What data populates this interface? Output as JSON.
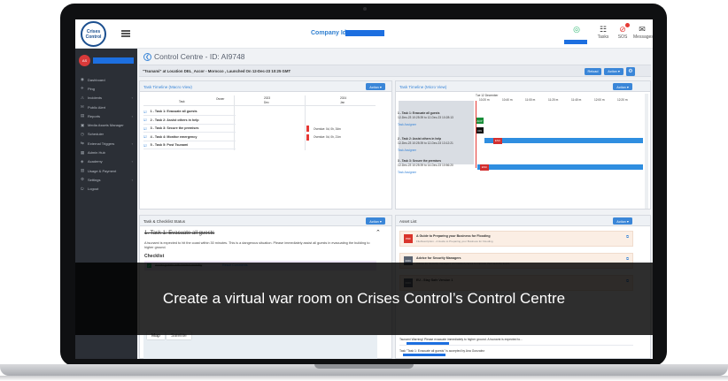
{
  "header": {
    "logo_text": "Crises Control",
    "company_label": "Company Id:",
    "tasks_label": "Tasks",
    "sos_label": "SOS",
    "messages_label": "Messages"
  },
  "user": {
    "avatar_initials": "AS"
  },
  "sidebar": {
    "items": [
      {
        "label": "Dashboard",
        "icon": "dashboard-icon",
        "glyph": "◉"
      },
      {
        "label": "Ping",
        "icon": "ping-icon",
        "glyph": "✈"
      },
      {
        "label": "Incidents",
        "icon": "incidents-icon",
        "glyph": "⚠",
        "arrow": "‹"
      },
      {
        "label": "Public Alert",
        "icon": "public-alert-icon",
        "glyph": "✉"
      },
      {
        "label": "Reports",
        "icon": "reports-icon",
        "glyph": "▤",
        "arrow": "‹"
      },
      {
        "label": "Media Assets Manager",
        "icon": "media-icon",
        "glyph": "▣"
      },
      {
        "label": "Scheduler",
        "icon": "scheduler-icon",
        "glyph": "◷"
      },
      {
        "label": "External Triggers",
        "icon": "triggers-icon",
        "glyph": "⇆",
        "arrow": "‹"
      },
      {
        "label": "Admin Hub",
        "icon": "admin-hub-icon",
        "glyph": "▦"
      },
      {
        "label": "Academy",
        "icon": "academy-icon",
        "glyph": "◈",
        "arrow": "‹"
      },
      {
        "label": "Usage & Payment",
        "icon": "payment-icon",
        "glyph": "▥"
      },
      {
        "label": "Settings",
        "icon": "settings-icon",
        "glyph": "⚙",
        "arrow": "‹"
      },
      {
        "label": "Logout",
        "icon": "logout-icon",
        "glyph": "⏻"
      }
    ]
  },
  "main": {
    "title": "Control Centre - ID: AI9748",
    "incident_text": "\"Tsunami\" at Location DEL_Accor - Morocco , Launched On 12-Dec-23 10:25 GMT",
    "reload_label": "Reload",
    "action_label": "Action ▾"
  },
  "macro": {
    "title": "Task Timeline (Macro View)",
    "col_task": "Task",
    "col_owner": "Owner",
    "year1": "2023",
    "year2": "2024",
    "month1": "Dec",
    "month2": "Jan",
    "tasks": [
      {
        "label": "1 - Task 1: Evacuate all guests",
        "note": ""
      },
      {
        "label": "2 - Task 2: Assist others in help",
        "note": ""
      },
      {
        "label": "3 - Task 3: Secure the premises",
        "note": "Overdue: 0d, 0h, 34m"
      },
      {
        "label": "4 - Task 4: Monitor emergency",
        "note": "Overdue: 0d, 0h, 21m"
      },
      {
        "label": "5 - Task 5: Post Tsunami",
        "note": ""
      }
    ]
  },
  "micro": {
    "title": "Task Timeline (Micro View)",
    "date": "Tue 12 December",
    "times": [
      "10:20 m",
      "10:40 m",
      "11:00 m",
      "11:20 m",
      "11:40 m",
      "12:00 m",
      "12:20 m"
    ],
    "entries": [
      {
        "title": "1 - Task 1: Evacuate all guests",
        "dates": "12-Dec-23 10:25:39 to 12-Dec-23 10:28:13",
        "link": "Task Assignee"
      },
      {
        "title": "2 - Task 2: Assist others in help",
        "dates": "12-Dec-23 10:25:39 to 12-Dec-23 13:12:21",
        "link": "Task Assignee"
      },
      {
        "title": "3 - Task 3: Secure the premises",
        "dates": "12-Dec-23 10:25:39 to 14-Dec-23 10:56:20",
        "link": "Task Assignee"
      }
    ],
    "box_acp": "ACP",
    "box_on": "ON",
    "box_esc": "ESC"
  },
  "checklist": {
    "title": "Task & Checklist Status",
    "task_heading": "1. Task 1: Evacuate all guests",
    "description": "A tsunami is expected to hit the coast within 30 minutes. This is a dangerous situation. Please immediately assist all guests in evacuating the building to higher ground.",
    "checklist_label": "Checklist",
    "item1": "Assist guests with limited mobility",
    "item1_note": "Result Comments",
    "map_tab1": "Map",
    "map_tab2": "Satellite"
  },
  "assets": {
    "title": "Asset List",
    "items": [
      {
        "title": "A Guide to Preparing your Business for Flooding",
        "desc": "FileDescription - A Guide to Preparing your Business for Flooding",
        "color": "#d9342b",
        "kind": "PDF"
      },
      {
        "title": "Advice for Security Managers",
        "desc": "Advice for Security managers of crowded places to improve their security levels",
        "color": "#5a6270",
        "kind": "DOC"
      },
      {
        "title": "EU - Stay Safe Version 1",
        "desc": "",
        "color": "#5a6270",
        "kind": "DOC"
      }
    ],
    "message1": "Tsunami Warning! Please evacuate immediately to higher ground. A tsunami is expected to...",
    "message2": "Task \"Task 1: Evacuate all guests\" is accepted by Ana Gonzalez"
  },
  "overlay_caption": "Create a virtual war room on Crises Control’s Control Centre",
  "colors": {
    "accent": "#3a86d8",
    "sidebar": "#2b2f36",
    "danger": "#e53935",
    "redact": "#1d6fe0"
  }
}
